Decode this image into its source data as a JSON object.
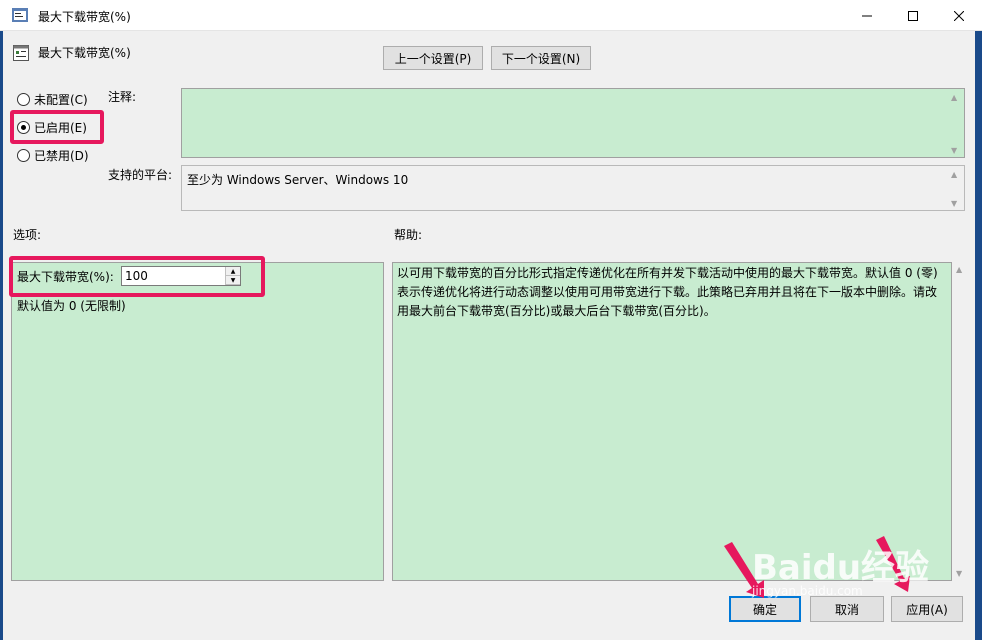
{
  "window": {
    "title": "最大下载带宽(%)",
    "minimize": "minimize",
    "maximize": "maximize",
    "close": "close"
  },
  "policy": {
    "name": "最大下载带宽(%)"
  },
  "nav": {
    "prev": "上一个设置(P)",
    "next": "下一个设置(N)"
  },
  "state": {
    "options": [
      {
        "label": "未配置(C)",
        "checked": false
      },
      {
        "label": "已启用(E)",
        "checked": true
      },
      {
        "label": "已禁用(D)",
        "checked": false
      }
    ]
  },
  "comment": {
    "label": "注释:",
    "value": ""
  },
  "platform": {
    "label": "支持的平台:",
    "value": "至少为 Windows Server、Windows 10"
  },
  "options_panel": {
    "heading": "选项:",
    "field_label": "最大下载带宽(%):",
    "field_value": "100",
    "default_note": "默认值为 0 (无限制)"
  },
  "help_panel": {
    "heading": "帮助:",
    "text": "以可用下载带宽的百分比形式指定传递优化在所有并发下载活动中使用的最大下载带宽。默认值 0 (零)表示传递优化将进行动态调整以使用可用带宽进行下载。此策略已弃用并且将在下一版本中删除。请改用最大前台下载带宽(百分比)或最大后台下载带宽(百分比)。"
  },
  "footer": {
    "ok": "确定",
    "cancel": "取消",
    "apply": "应用(A)"
  },
  "watermark": {
    "brand": "Baidu经验",
    "url": "jingyan.baidu.com"
  },
  "colors": {
    "highlight": "#e6185d",
    "panel_green": "#c8ecd0",
    "frame": "#1a4a8a"
  }
}
